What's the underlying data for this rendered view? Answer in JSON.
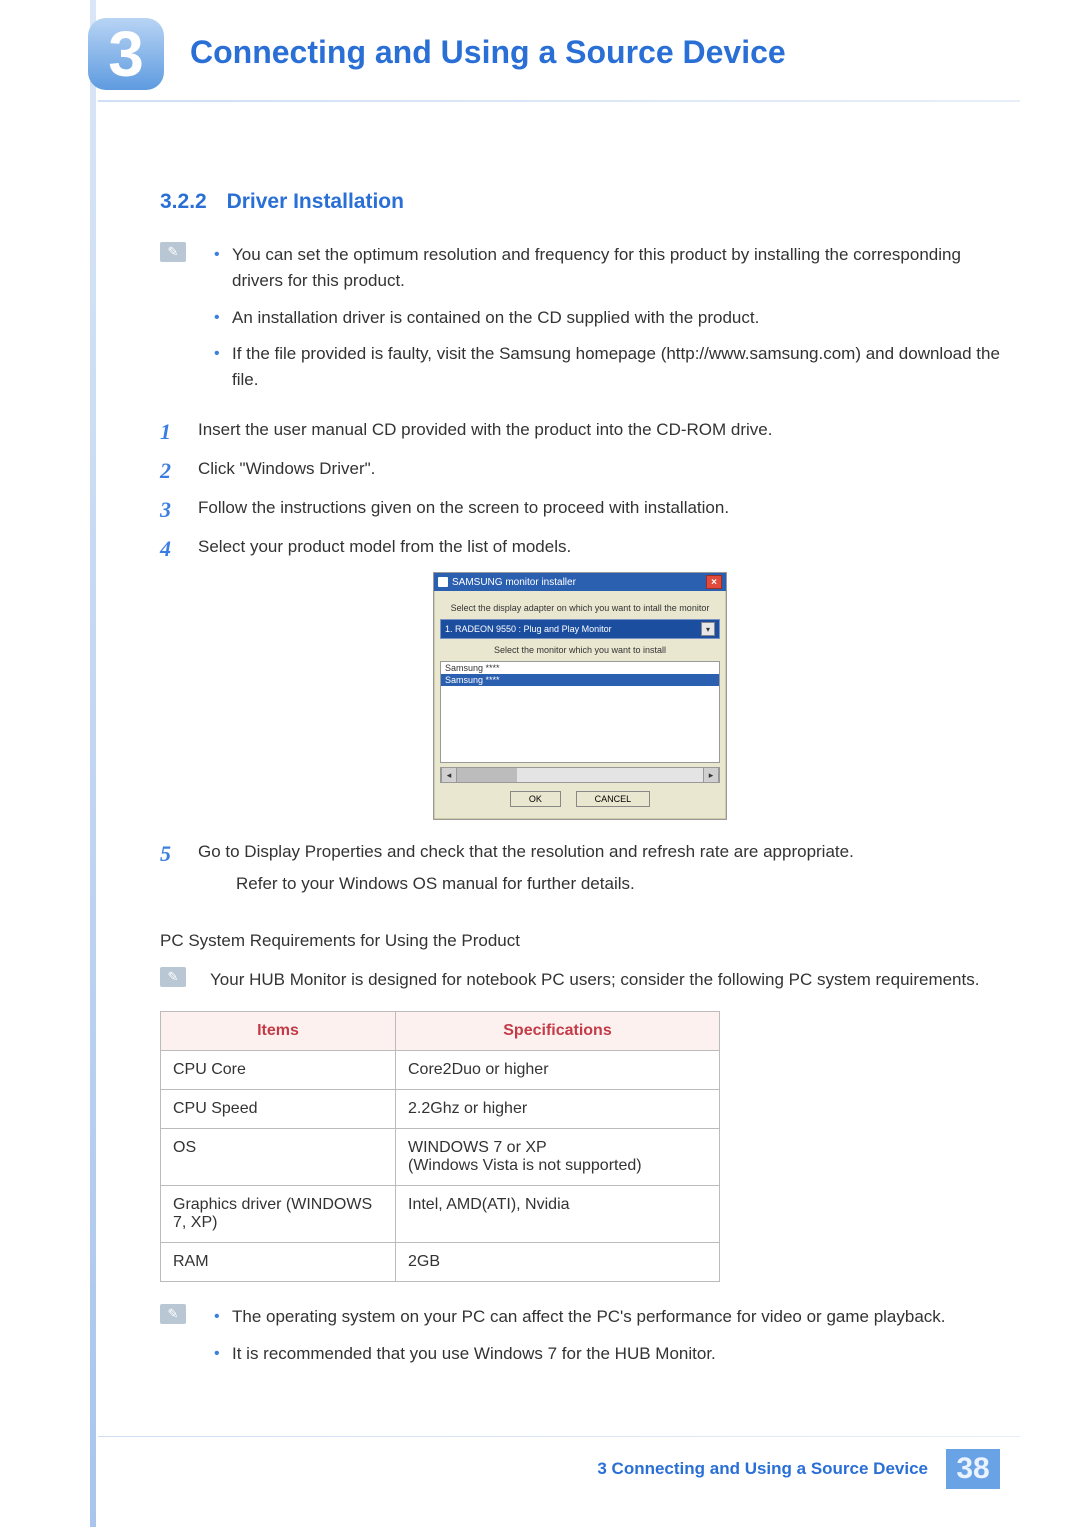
{
  "chapter": {
    "number": "3",
    "title": "Connecting and Using a Source Device"
  },
  "section": {
    "number": "3.2.2",
    "title": "Driver Installation"
  },
  "note1": [
    "You can set the optimum resolution and frequency for this product by installing the corresponding drivers for this product.",
    "An installation driver is contained on the CD supplied with the product.",
    "If the file provided is faulty, visit the Samsung homepage (http://www.samsung.com) and download the file."
  ],
  "steps_a": [
    "Insert the user manual CD provided with the product into the CD-ROM drive.",
    "Click \"Windows Driver\".",
    "Follow the instructions given on the screen to proceed with installation.",
    "Select your product model from the list of models."
  ],
  "steps_b": {
    "num": "5",
    "text": "Go to Display Properties and check that the resolution and refresh rate are appropriate.",
    "sub": "Refer to your Windows OS manual for further details."
  },
  "installer": {
    "title": "SAMSUNG monitor installer",
    "prompt1": "Select the display adapter on which you want to intall the monitor",
    "combo": "1. RADEON 9550 : Plug and Play Monitor",
    "prompt2": "Select the monitor which you want to install",
    "list": [
      "Samsung ****",
      "Samsung ****"
    ],
    "ok": "OK",
    "cancel": "CANCEL"
  },
  "req_heading": "PC System Requirements for Using the Product",
  "req_note": "Your HUB Monitor is designed for notebook PC users; consider the following PC system requirements.",
  "table": {
    "headers": [
      "Items",
      "Specifications"
    ],
    "rows": [
      [
        "CPU Core",
        "Core2Duo or higher"
      ],
      [
        "CPU Speed",
        "2.2Ghz or higher"
      ],
      [
        "OS",
        "WINDOWS 7 or XP\n(Windows Vista is not supported)"
      ],
      [
        "Graphics driver (WINDOWS 7, XP)",
        "Intel, AMD(ATI), Nvidia"
      ],
      [
        "RAM",
        "2GB"
      ]
    ]
  },
  "note2": [
    "The operating system on your PC can affect the PC's performance for video or game playback.",
    "It is recommended that you use Windows 7 for the HUB Monitor."
  ],
  "footer": {
    "chapter_label": "3 Connecting and Using a Source Device",
    "page": "38"
  }
}
